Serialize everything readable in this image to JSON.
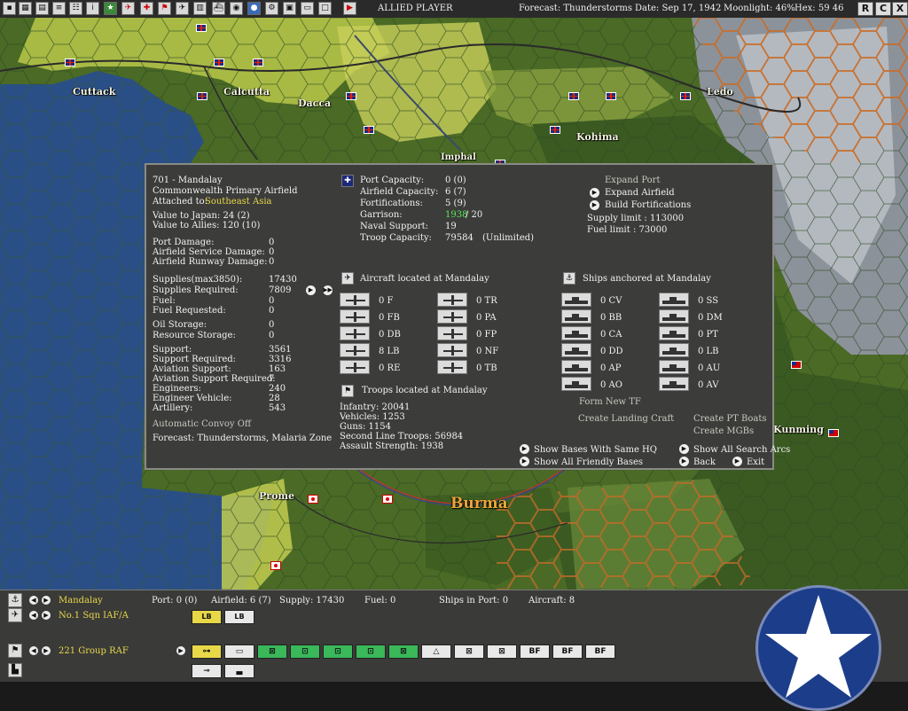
{
  "top_bar": {
    "player": "ALLIED PLAYER",
    "forecast": "Forecast: Thunderstorms",
    "date": "Date: Sep 17, 1942",
    "moonlight": "Moonlight: 46%",
    "hex": "Hex: 59 46",
    "right_buttons": [
      "R",
      "C",
      "X"
    ]
  },
  "map": {
    "cities": [
      "Cuttack",
      "Calcutta",
      "Dacca",
      "Imphal",
      "Kohima",
      "Ledo",
      "Prome",
      "Burma",
      "Kunming"
    ]
  },
  "base": {
    "title": "701 - Mandalay",
    "type": "Commonwealth Primary Airfield",
    "attached_label": "Attached to:",
    "attached_value": "Southeast Asia",
    "value_japan": "Value to Japan: 24 (2)",
    "value_allies": "Value to Allies: 120 (10)",
    "damage": [
      {
        "label": "Port Damage:",
        "value": "0"
      },
      {
        "label": "Airfield Service Damage:",
        "value": "0"
      },
      {
        "label": "Airfield Runway Damage:",
        "value": "0"
      }
    ],
    "supply": [
      {
        "label": "Supplies(max3850):",
        "value": "17430"
      },
      {
        "label": "Supplies Required:",
        "value": "7809"
      },
      {
        "label": "Fuel:",
        "value": "0"
      },
      {
        "label": "Fuel Requested:",
        "value": "0"
      }
    ],
    "storage": [
      {
        "label": "Oil Storage:",
        "value": "0"
      },
      {
        "label": "Resource Storage:",
        "value": "0"
      }
    ],
    "support": [
      {
        "label": "Support:",
        "value": "3561"
      },
      {
        "label": "Support Required:",
        "value": "3316"
      },
      {
        "label": "Aviation Support:",
        "value": "163"
      },
      {
        "label": "Aviation Support Required:",
        "value": "7"
      },
      {
        "label": "Engineers:",
        "value": "240"
      },
      {
        "label": "Engineer Vehicle:",
        "value": "28"
      },
      {
        "label": "Artillery:",
        "value": "543"
      }
    ],
    "convoy": "Automatic Convoy Off",
    "forecast": "Forecast: Thunderstorms, Malaria Zone"
  },
  "capacity": {
    "port_label": "Port Capacity:",
    "port_value": "0 (0)",
    "airfield_label": "Airfield Capacity:",
    "airfield_value": "6 (7)",
    "fort_label": "Fortifications:",
    "fort_value": "5 (9)",
    "garrison_label": "Garrison:",
    "garrison_value": "1938",
    "garrison_req": " / 20",
    "naval_label": "Naval Support:",
    "naval_value": "19",
    "troop_label": "Troop Capacity:",
    "troop_value": "79584",
    "troop_note": "(Unlimited)"
  },
  "actions": {
    "expand_port": "Expand Port",
    "expand_airfield": "Expand Airfield",
    "build_fort": "Build Fortifications",
    "supply_limit": "Supply limit : 113000",
    "fuel_limit": "Fuel limit : 73000"
  },
  "aircraft": {
    "header": "Aircraft located at Mandalay",
    "left": [
      "0 F",
      "0 FB",
      "0 DB",
      "8 LB",
      "0 RE"
    ],
    "right": [
      "0 TR",
      "0 PA",
      "0 FP",
      "0 NF",
      "0 TB"
    ]
  },
  "ships": {
    "header": "Ships anchored at Mandalay",
    "left": [
      "0 CV",
      "0 BB",
      "0 CA",
      "0 DD",
      "0 AP",
      "0 AO"
    ],
    "right": [
      "0 SS",
      "0 DM",
      "0 PT",
      "0 LB",
      "0 AU",
      "0 AV"
    ],
    "form_tf": "Form New TF",
    "create_landing": "Create Landing Craft",
    "create_pt": "Create PT Boats",
    "create_mgb": "Create MGBs"
  },
  "troops": {
    "header": "Troops located at Mandalay",
    "infantry": "Infantry: 20041",
    "vehicles": "Vehicles: 1253",
    "guns": "Guns: 1154",
    "second_line": "Second Line Troops: 56984",
    "assault": "Assault Strength: 1938"
  },
  "links": {
    "same_hq": "Show Bases With Same HQ",
    "search_arcs": "Show All Search Arcs",
    "friendly": "Show All Friendly Bases",
    "back": "Back",
    "exit": "Exit"
  },
  "bottom": {
    "base_name": "Mandalay",
    "port": "Port: 0 (0)",
    "airfield": "Airfield: 6 (7)",
    "supply": "Supply: 17430",
    "fuel": "Fuel: 0",
    "ships_in_port": "Ships in Port: 0",
    "aircraft": "Aircraft: 8",
    "squadron": "No.1 Sqn IAF/A",
    "group": "221 Group RAF",
    "lb_label": "LB",
    "bf_label": "BF"
  },
  "colors": {
    "dialog_bg": "#3c3c3a",
    "highlight_yellow": "#e8d84a",
    "garrison_green": "#58e858",
    "ocean": "#2a4f86",
    "roundel_blue": "#1c3d8a"
  }
}
